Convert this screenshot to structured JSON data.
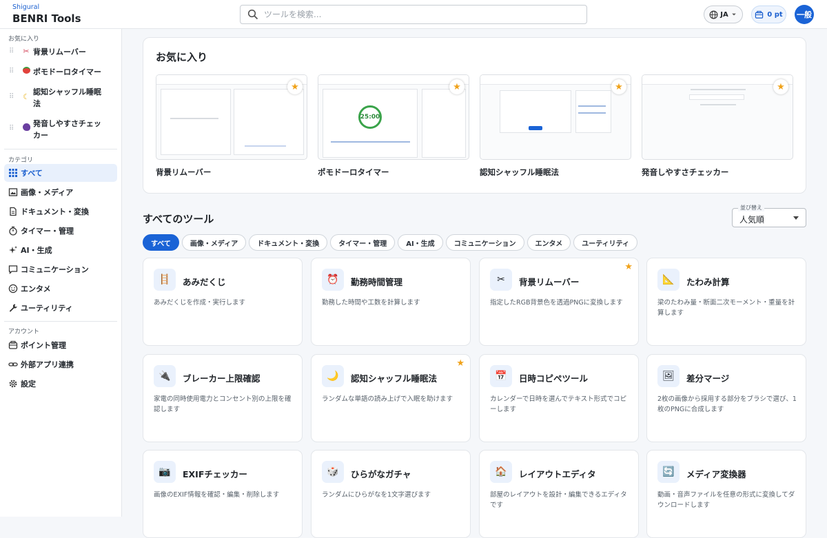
{
  "header": {
    "brand_sub": "Shigural",
    "brand": "BENRI Tools",
    "search_placeholder": "ツールを検索...",
    "lang": "JA",
    "points": "0 pt",
    "avatar": "一般"
  },
  "sidebar": {
    "favorites_label": "お気に入り",
    "favorites": [
      {
        "label": "背景リムーバー",
        "icon": "scissors-icon",
        "glyph": "✂"
      },
      {
        "label": "ポモドーロタイマー",
        "icon": "tomato-icon",
        "glyph": "🍅"
      },
      {
        "label": "認知シャッフル睡眠法",
        "icon": "moon-icon",
        "glyph": "🌙"
      },
      {
        "label": "発音しやすさチェッカー",
        "icon": "speaking-head-icon",
        "glyph": "🗣"
      }
    ],
    "category_label": "カテゴリ",
    "categories": [
      {
        "label": "すべて",
        "icon": "grid-icon",
        "active": true
      },
      {
        "label": "画像・メディア",
        "icon": "image-icon"
      },
      {
        "label": "ドキュメント・変換",
        "icon": "document-icon"
      },
      {
        "label": "タイマー・管理",
        "icon": "timer-icon"
      },
      {
        "label": "AI・生成",
        "icon": "sparkle-icon"
      },
      {
        "label": "コミュニケーション",
        "icon": "chat-icon"
      },
      {
        "label": "エンタメ",
        "icon": "smiley-icon"
      },
      {
        "label": "ユーティリティ",
        "icon": "wrench-icon"
      }
    ],
    "account_label": "アカウント",
    "account": [
      {
        "label": "ポイント管理",
        "icon": "wallet-icon"
      },
      {
        "label": "外部アプリ連携",
        "icon": "link-icon"
      },
      {
        "label": "設定",
        "icon": "gear-icon"
      }
    ]
  },
  "favorites_panel": {
    "title": "お気に入り",
    "items": [
      {
        "name": "背景リムーバー"
      },
      {
        "name": "ポモドーロタイマー",
        "timer": "25:00"
      },
      {
        "name": "認知シャッフル睡眠法"
      },
      {
        "name": "発音しやすさチェッカー"
      }
    ]
  },
  "all_tools": {
    "title": "すべてのツール",
    "sort_caption": "並び替え",
    "sort_value": "人気順",
    "chips": [
      "すべて",
      "画像・メディア",
      "ドキュメント・変換",
      "タイマー・管理",
      "AI・生成",
      "コミュニケーション",
      "エンタメ",
      "ユーティリティ"
    ],
    "tools": [
      {
        "name": "あみだくじ",
        "desc": "あみだくじを作成・実行します",
        "glyph": "🪜",
        "fav": false
      },
      {
        "name": "勤務時間管理",
        "desc": "勤務した時間や工数を計算します",
        "glyph": "⏰",
        "fav": false
      },
      {
        "name": "背景リムーバー",
        "desc": "指定したRGB背景色を透過PNGに変換します",
        "glyph": "✂",
        "fav": true
      },
      {
        "name": "たわみ計算",
        "desc": "梁のたわみ量・断面二次モーメント・重量を計算します",
        "glyph": "📐",
        "fav": false
      },
      {
        "name": "ブレーカー上限確認",
        "desc": "家電の同時使用電力とコンセント別の上限を確認します",
        "glyph": "🔌",
        "fav": false
      },
      {
        "name": "認知シャッフル睡眠法",
        "desc": "ランダムな単語の読み上げで入眠を助けます",
        "glyph": "🌙",
        "fav": true
      },
      {
        "name": "日時コピペツール",
        "desc": "カレンダーで日時を選んでテキスト形式でコピーします",
        "glyph": "📅",
        "fav": false
      },
      {
        "name": "差分マージ",
        "desc": "2枚の画像から採用する部分をブラシで選び、1枚のPNGに合成します",
        "glyph": "🖼",
        "fav": false
      },
      {
        "name": "EXIFチェッカー",
        "desc": "画像のEXIF情報を確認・編集・削除します",
        "glyph": "📷",
        "fav": false
      },
      {
        "name": "ひらがなガチャ",
        "desc": "ランダムにひらがなを1文字選びます",
        "glyph": "🎲",
        "fav": false
      },
      {
        "name": "レイアウトエディタ",
        "desc": "部屋のレイアウトを設計・編集できるエディタです",
        "glyph": "🏠",
        "fav": false
      },
      {
        "name": "メディア変換器",
        "desc": "動画・音声ファイルを任意の形式に変換してダウンロードします",
        "glyph": "🔄",
        "fav": false
      }
    ]
  }
}
